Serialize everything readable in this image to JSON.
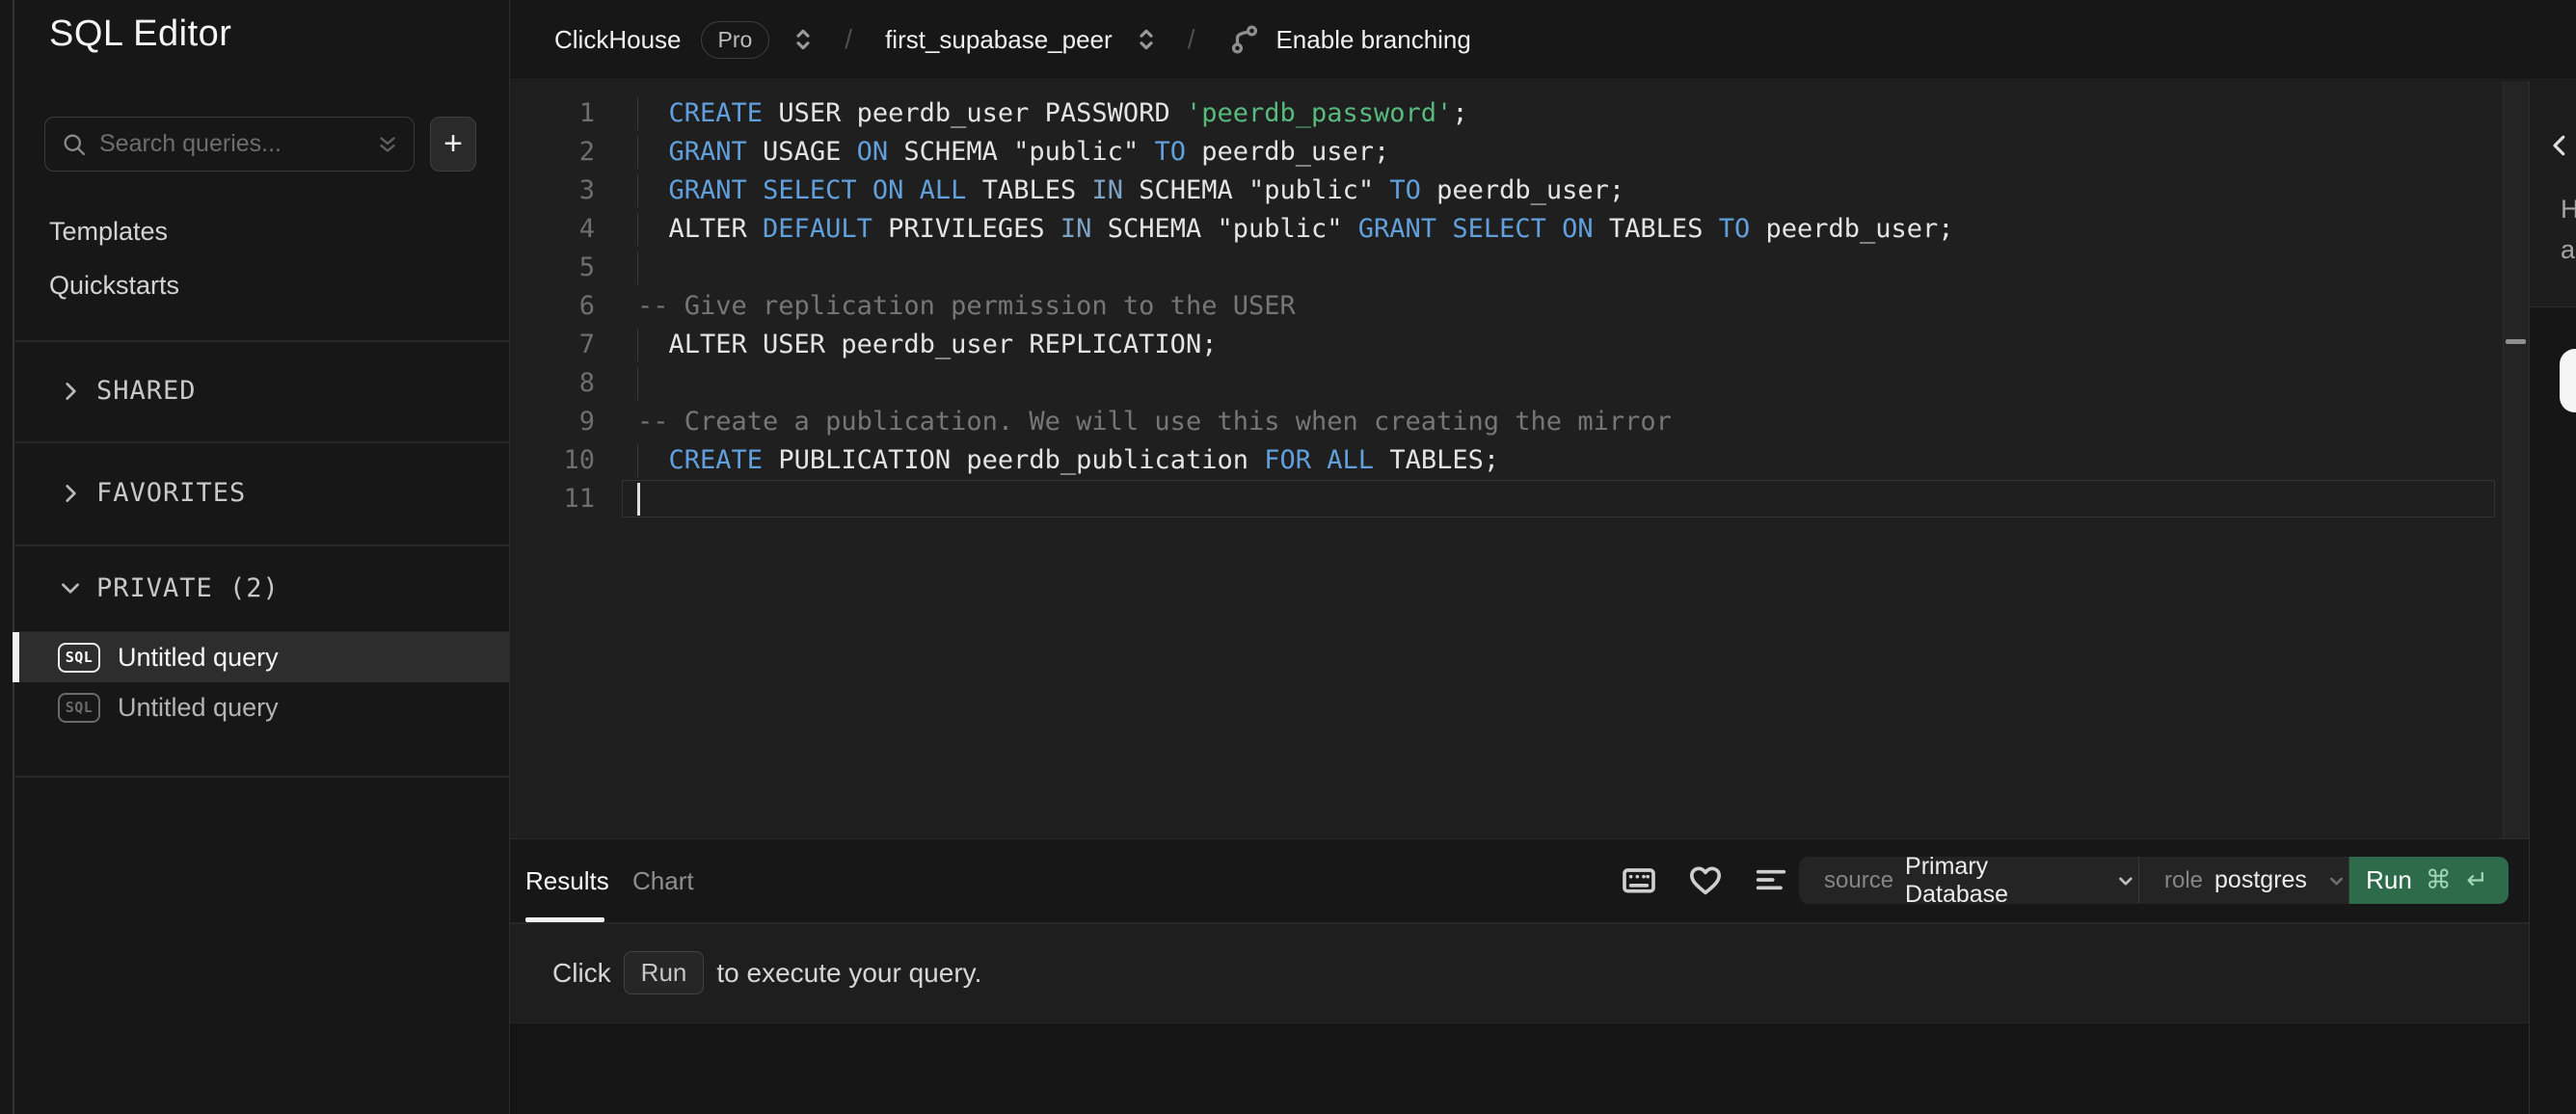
{
  "sidebar": {
    "title": "SQL Editor",
    "search_placeholder": "Search queries...",
    "new_query_glyph": "+",
    "nav": [
      {
        "label": "Templates"
      },
      {
        "label": "Quickstarts"
      }
    ],
    "sections": [
      {
        "label": "SHARED",
        "collapsed": true
      },
      {
        "label": "FAVORITES",
        "collapsed": true
      },
      {
        "label": "PRIVATE (2)",
        "collapsed": false
      }
    ],
    "queries": [
      {
        "badge": "SQL",
        "label": "Untitled query",
        "selected": true
      },
      {
        "badge": "SQL",
        "label": "Untitled query",
        "selected": false
      }
    ]
  },
  "topbar": {
    "service": "ClickHouse",
    "plan_badge": "Pro",
    "separator": "/",
    "query_name": "first_supabase_peer",
    "branching_label": "Enable branching"
  },
  "editor": {
    "lines": [
      {
        "n": "1",
        "guide": true,
        "active": false,
        "tokens": [
          [
            "  ",
            "pln"
          ],
          [
            "CREATE",
            "kw"
          ],
          [
            " USER peerdb_user PASSWORD ",
            "pln"
          ],
          [
            "'peerdb_password'",
            "str"
          ],
          [
            ";",
            "pln"
          ]
        ]
      },
      {
        "n": "2",
        "guide": true,
        "active": false,
        "tokens": [
          [
            "  ",
            "pln"
          ],
          [
            "GRANT",
            "kw"
          ],
          [
            " USAGE ",
            "pln"
          ],
          [
            "ON",
            "kw"
          ],
          [
            " SCHEMA \"public\" ",
            "pln"
          ],
          [
            "TO",
            "kw"
          ],
          [
            " peerdb_user;",
            "pln"
          ]
        ]
      },
      {
        "n": "3",
        "guide": true,
        "active": false,
        "tokens": [
          [
            "  ",
            "pln"
          ],
          [
            "GRANT",
            "kw"
          ],
          [
            " ",
            "pln"
          ],
          [
            "SELECT",
            "kw"
          ],
          [
            " ",
            "pln"
          ],
          [
            "ON",
            "kw"
          ],
          [
            " ",
            "pln"
          ],
          [
            "ALL",
            "kw"
          ],
          [
            " TABLES ",
            "pln"
          ],
          [
            "IN",
            "kw2"
          ],
          [
            " SCHEMA \"public\" ",
            "pln"
          ],
          [
            "TO",
            "kw"
          ],
          [
            " peerdb_user;",
            "pln"
          ]
        ]
      },
      {
        "n": "4",
        "guide": true,
        "active": false,
        "tokens": [
          [
            "  ALTER ",
            "pln"
          ],
          [
            "DEFAULT",
            "kw"
          ],
          [
            " PRIVILEGES ",
            "pln"
          ],
          [
            "IN",
            "kw2"
          ],
          [
            " SCHEMA \"public\" ",
            "pln"
          ],
          [
            "GRANT",
            "kw"
          ],
          [
            " ",
            "pln"
          ],
          [
            "SELECT",
            "kw"
          ],
          [
            " ",
            "pln"
          ],
          [
            "ON",
            "kw"
          ],
          [
            " TABLES ",
            "pln"
          ],
          [
            "TO",
            "kw"
          ],
          [
            " peerdb_user;",
            "pln"
          ]
        ]
      },
      {
        "n": "5",
        "guide": true,
        "active": false,
        "tokens": []
      },
      {
        "n": "6",
        "guide": false,
        "active": false,
        "tokens": [
          [
            "-- Give replication permission to the USER",
            "com"
          ]
        ]
      },
      {
        "n": "7",
        "guide": true,
        "active": false,
        "tokens": [
          [
            "  ALTER USER peerdb_user REPLICATION;",
            "pln"
          ]
        ]
      },
      {
        "n": "8",
        "guide": true,
        "active": false,
        "tokens": []
      },
      {
        "n": "9",
        "guide": false,
        "active": false,
        "tokens": [
          [
            "-- Create a publication. We will use this when creating the mirror",
            "com"
          ]
        ]
      },
      {
        "n": "10",
        "guide": true,
        "active": false,
        "tokens": [
          [
            "  ",
            "pln"
          ],
          [
            "CREATE",
            "kw"
          ],
          [
            " PUBLICATION peerdb_publication ",
            "pln"
          ],
          [
            "FOR",
            "kw"
          ],
          [
            " ",
            "pln"
          ],
          [
            "ALL",
            "kw"
          ],
          [
            " TABLES;",
            "pln"
          ]
        ]
      },
      {
        "n": "11",
        "guide": false,
        "active": true,
        "tokens": []
      }
    ]
  },
  "results_panel": {
    "tabs": [
      {
        "label": "Results",
        "active": true
      },
      {
        "label": "Chart",
        "active": false
      }
    ],
    "source_label": "source",
    "source_value": "Primary Database",
    "role_label": "role",
    "role_value": "postgres",
    "run_label": "Run",
    "run_shortcut": "⌘ ↵",
    "message_prefix": "Click",
    "message_kbd": "Run",
    "message_suffix": "to execute your query."
  },
  "right_rail": {
    "text_fragments": [
      "H",
      "a"
    ]
  },
  "colors": {
    "accent_run_green": "#2e6b4a",
    "keyword_blue": "#61a0dc",
    "string_green": "#58ba7d",
    "comment_gray": "#767676",
    "selected_row": "#2d2d2d"
  }
}
